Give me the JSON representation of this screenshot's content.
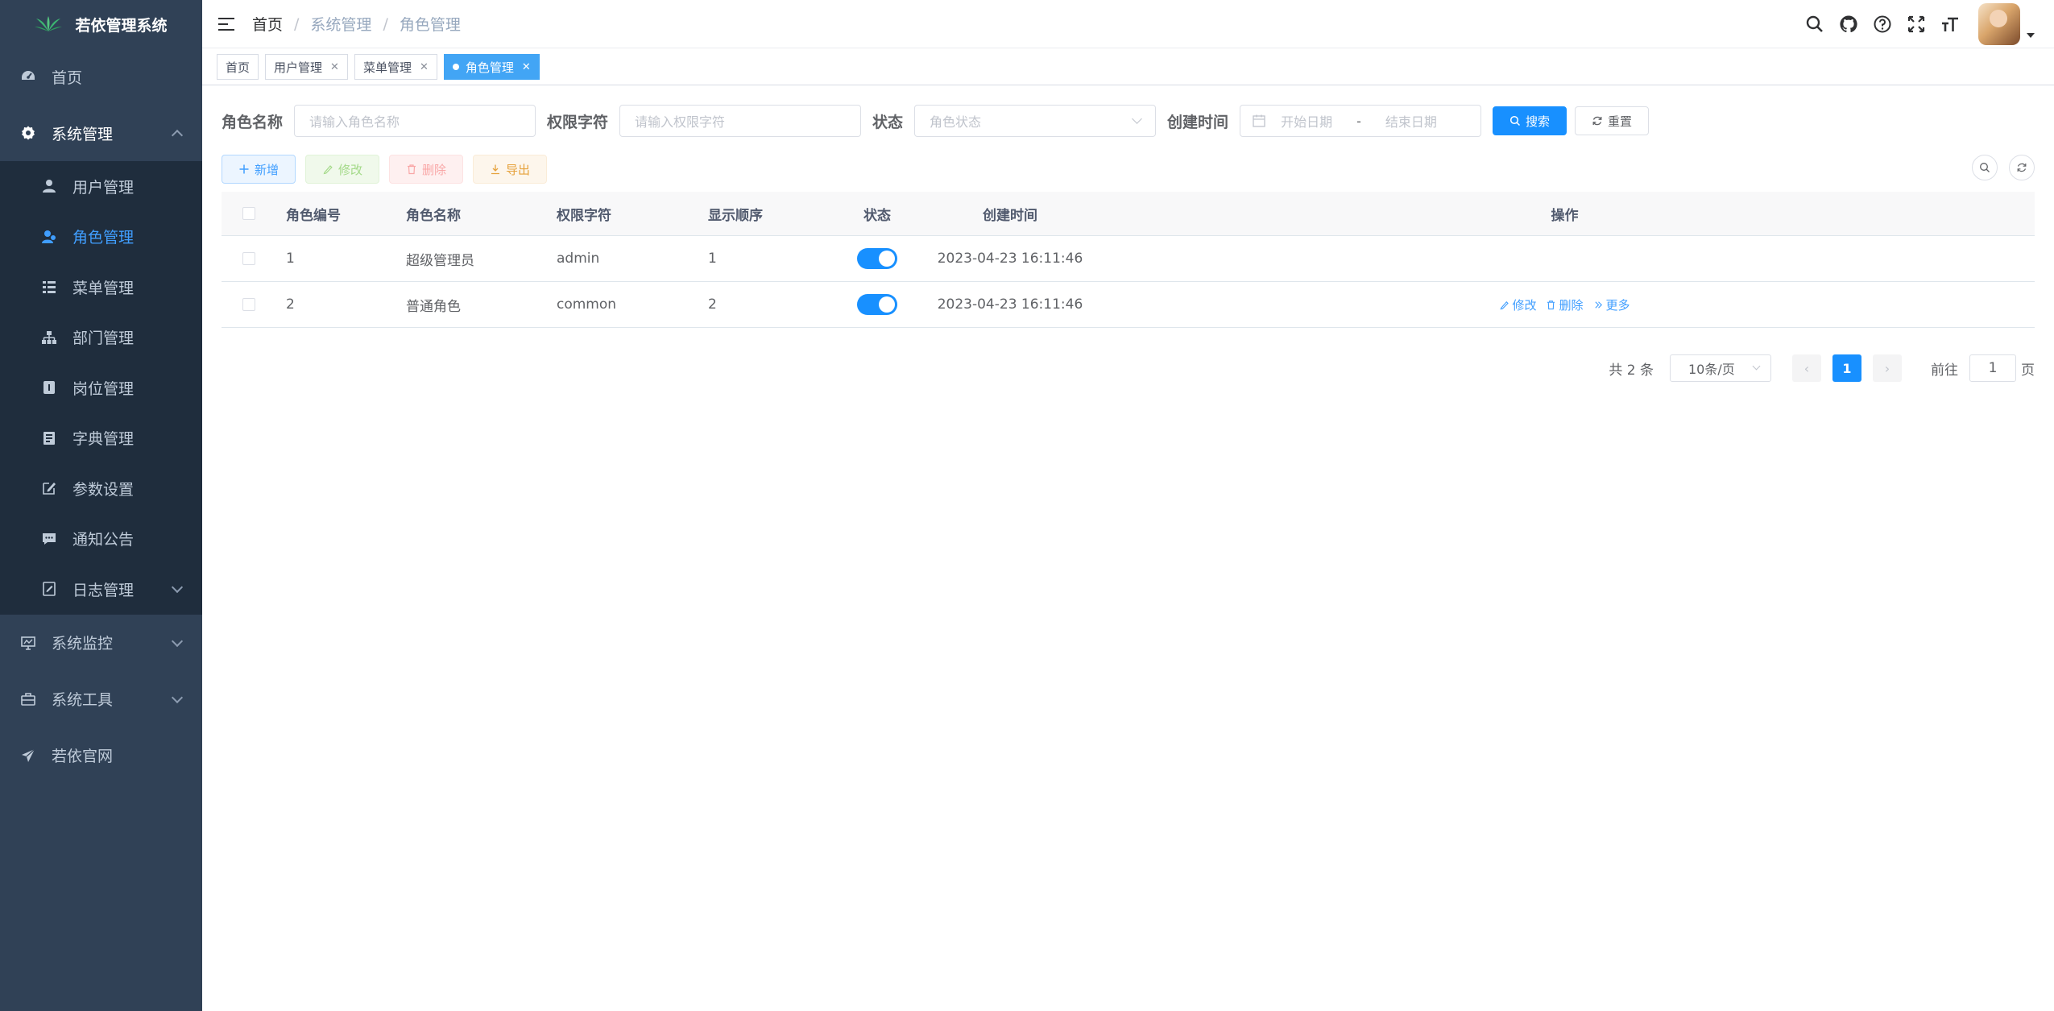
{
  "app": {
    "title": "若依管理系统"
  },
  "sidebar": {
    "items": [
      {
        "label": "首页",
        "icon": "dashboard-icon"
      },
      {
        "label": "系统管理",
        "icon": "gear-icon"
      },
      {
        "label": "系统监控",
        "icon": "monitor-icon"
      },
      {
        "label": "系统工具",
        "icon": "toolbox-icon"
      },
      {
        "label": "若依官网",
        "icon": "paper-plane-icon"
      }
    ],
    "submenu": [
      {
        "label": "用户管理",
        "icon": "user-icon"
      },
      {
        "label": "角色管理",
        "icon": "role-icon"
      },
      {
        "label": "菜单管理",
        "icon": "tree-table-icon"
      },
      {
        "label": "部门管理",
        "icon": "org-tree-icon"
      },
      {
        "label": "岗位管理",
        "icon": "post-icon"
      },
      {
        "label": "字典管理",
        "icon": "dict-icon"
      },
      {
        "label": "参数设置",
        "icon": "edit-icon"
      },
      {
        "label": "通知公告",
        "icon": "message-icon"
      },
      {
        "label": "日志管理",
        "icon": "log-icon"
      }
    ],
    "active": "角色管理"
  },
  "breadcrumb": [
    "首页",
    "系统管理",
    "角色管理"
  ],
  "tags": [
    {
      "label": "首页",
      "closable": false
    },
    {
      "label": "用户管理",
      "closable": true
    },
    {
      "label": "菜单管理",
      "closable": true
    },
    {
      "label": "角色管理",
      "closable": true,
      "active": true
    }
  ],
  "search": {
    "role_name_label": "角色名称",
    "role_name_placeholder": "请输入角色名称",
    "role_key_label": "权限字符",
    "role_key_placeholder": "请输入权限字符",
    "status_label": "状态",
    "status_placeholder": "角色状态",
    "created_label": "创建时间",
    "start_placeholder": "开始日期",
    "range_sep": "-",
    "end_placeholder": "结束日期",
    "search_btn": "搜索",
    "reset_btn": "重置"
  },
  "toolbar": {
    "add": "新增",
    "edit": "修改",
    "delete": "删除",
    "export": "导出"
  },
  "table": {
    "headers": [
      "角色编号",
      "角色名称",
      "权限字符",
      "显示顺序",
      "状态",
      "创建时间",
      "操作"
    ],
    "rows": [
      {
        "id": "1",
        "name": "超级管理员",
        "key": "admin",
        "sort": "1",
        "status": true,
        "created": "2023-04-23 16:11:46",
        "ops": []
      },
      {
        "id": "2",
        "name": "普通角色",
        "key": "common",
        "sort": "2",
        "status": true,
        "created": "2023-04-23 16:11:46",
        "ops": [
          "修改",
          "删除",
          "更多"
        ]
      }
    ]
  },
  "pagination": {
    "total_text": "共 2 条",
    "page_size": "10条/页",
    "current_page": "1",
    "goto_prefix": "前往",
    "goto_value": "1",
    "goto_suffix": "页"
  },
  "colors": {
    "sidebar_bg": "#304156",
    "submenu_bg": "#1f2d3d",
    "primary": "#1890ff",
    "active_menu": "#409eff"
  }
}
